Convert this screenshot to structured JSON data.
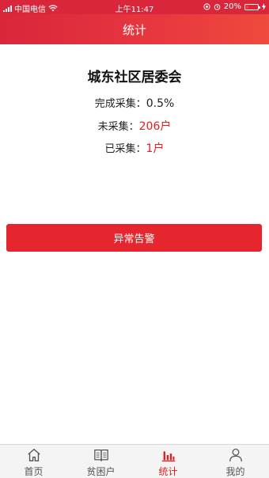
{
  "status_bar": {
    "carrier": "中国电信",
    "time": "上午11:47",
    "battery": "20%",
    "battery_level": 0.2
  },
  "header": {
    "title": "统计"
  },
  "summary": {
    "org_name": "城东社区居委会",
    "completed_label": "完成采集：",
    "completed_value": "0.5%",
    "uncollected_label": "未采集：",
    "uncollected_value": "206户",
    "collected_label": "已采集：",
    "collected_value": "1户"
  },
  "actions": {
    "alert_button": "异常告警"
  },
  "tabbar": {
    "tabs": [
      {
        "label": "首页",
        "icon": "home-icon"
      },
      {
        "label": "贫困户",
        "icon": "book-icon"
      },
      {
        "label": "统计",
        "icon": "bar-chart-icon",
        "active": true
      },
      {
        "label": "我的",
        "icon": "person-icon"
      }
    ]
  },
  "colors": {
    "accent": "#e5262e",
    "active_tab": "#e02020"
  }
}
